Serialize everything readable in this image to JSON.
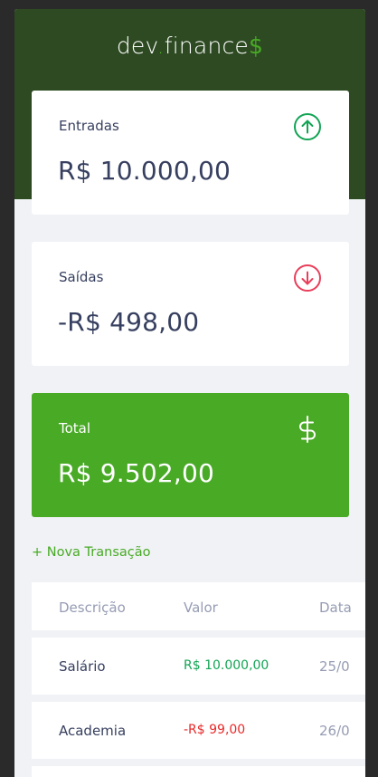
{
  "header": {
    "logo_dev": "dev",
    "logo_dot": ".",
    "logo_finance": "finance",
    "logo_dollar": "$"
  },
  "cards": {
    "income": {
      "label": "Entradas",
      "amount": "R$ 10.000,00",
      "icon": "arrow-up-circle-icon"
    },
    "expense": {
      "label": "Saídas",
      "amount": "-R$ 498,00",
      "icon": "arrow-down-circle-icon"
    },
    "total": {
      "label": "Total",
      "amount": "R$ 9.502,00",
      "icon": "dollar-sign-icon"
    }
  },
  "new_transaction_label": "+ Nova Transação",
  "table": {
    "headers": [
      "Descrição",
      "Valor",
      "Data"
    ],
    "rows": [
      {
        "description": "Salário",
        "amount": "R$ 10.000,00",
        "date": "25/0",
        "type": "income"
      },
      {
        "description": "Academia",
        "amount": "-R$ 99,00",
        "date": "26/0",
        "type": "expense"
      }
    ]
  },
  "colors": {
    "header_bg": "#2d4a22",
    "accent_green": "#49aa26",
    "income": "#12a454",
    "expense": "#e92929",
    "text": "#363f5f",
    "muted": "#969cb3",
    "page_bg": "#f0f2f5"
  }
}
